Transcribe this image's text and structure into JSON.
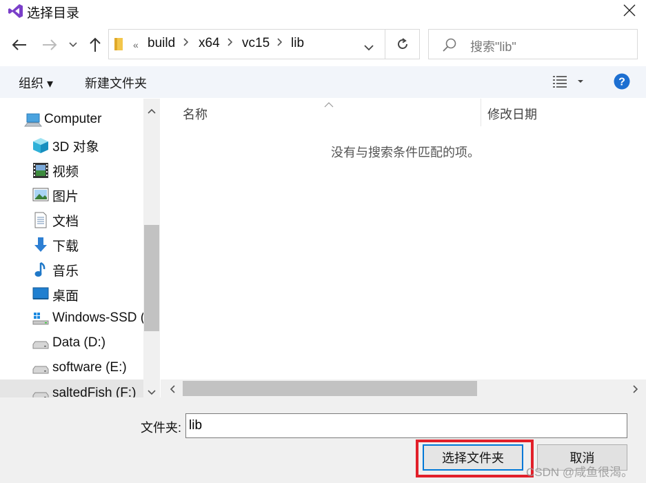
{
  "window": {
    "title": "选择目录",
    "close_icon": "close-icon",
    "app_icon": "visual-studio-icon"
  },
  "address": {
    "crumbs": [
      "build",
      "x64",
      "vc15",
      "lib"
    ],
    "overflow": "«"
  },
  "search": {
    "placeholder": "搜索\"lib\""
  },
  "toolbar": {
    "organize": "组织 ▾",
    "new_folder": "新建文件夹"
  },
  "nav": {
    "items": [
      {
        "label": "Computer",
        "icon": "computer-icon"
      },
      {
        "label": "3D 对象",
        "icon": "3d-objects-icon"
      },
      {
        "label": "视频",
        "icon": "video-icon"
      },
      {
        "label": "图片",
        "icon": "pictures-icon"
      },
      {
        "label": "文档",
        "icon": "documents-icon"
      },
      {
        "label": "下载",
        "icon": "download-icon"
      },
      {
        "label": "音乐",
        "icon": "music-icon"
      },
      {
        "label": "桌面",
        "icon": "desktop-icon"
      },
      {
        "label": "Windows-SSD (",
        "icon": "windows-drive-icon"
      },
      {
        "label": "Data (D:)",
        "icon": "drive-icon"
      },
      {
        "label": "software (E:)",
        "icon": "drive-icon"
      },
      {
        "label": "saltedFish (F:)",
        "icon": "drive-icon"
      }
    ]
  },
  "filelist": {
    "columns": [
      "名称",
      "修改日期"
    ],
    "empty_message": "没有与搜索条件匹配的项。"
  },
  "footer": {
    "folder_label": "文件夹:",
    "folder_value": "lib",
    "select_button": "选择文件夹",
    "cancel_button": "取消"
  },
  "watermark": "CSDN @咸鱼很渴。",
  "colors": {
    "accent": "#0078d7",
    "highlight": "#e2202a",
    "help": "#1d6fd1"
  }
}
